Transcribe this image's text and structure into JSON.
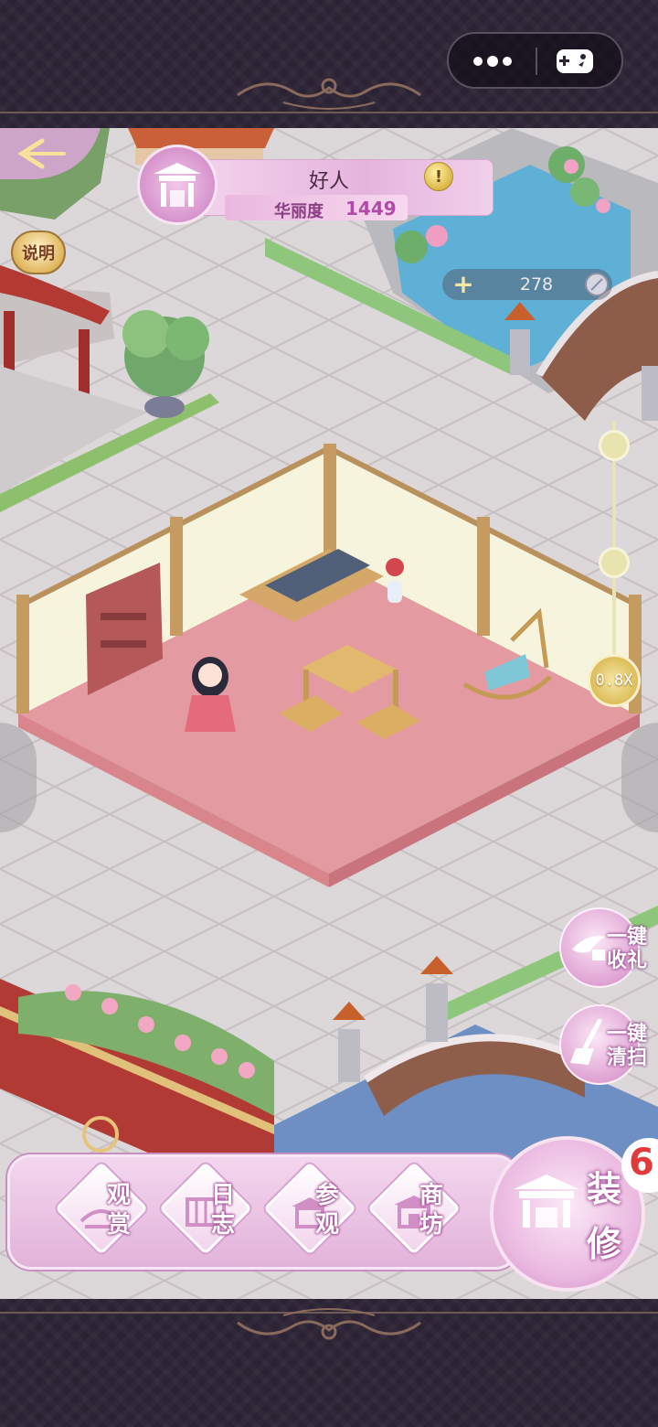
{
  "capsule": {
    "more_icon": "more-dots-icon",
    "game_icon": "gamepad-icon"
  },
  "top_bar": {
    "help_label": "说明",
    "profile": {
      "name": "好人",
      "score_label": "华丽度",
      "score_value": "1449",
      "alert_label": "!"
    },
    "currency": {
      "plus_label": "+",
      "amount": "278"
    }
  },
  "zoom": {
    "level_label": "0.8X",
    "levels": 3,
    "current_level": 3
  },
  "side_actions": [
    {
      "label": "一键收礼",
      "line1": "一键",
      "line2": "收礼",
      "icon": "bird-gift-icon"
    },
    {
      "label": "一键清扫",
      "line1": "一键",
      "line2": "清扫",
      "icon": "broom-icon"
    }
  ],
  "bottom_menu": [
    {
      "line1": "观",
      "line2": "赏",
      "icon": "view-icon"
    },
    {
      "line1": "日",
      "line2": "志",
      "icon": "journal-icon"
    },
    {
      "line1": "参",
      "line2": "观",
      "icon": "visit-icon"
    },
    {
      "line1": "商",
      "line2": "坊",
      "icon": "shop-icon"
    }
  ],
  "decorate": {
    "line1": "装",
    "line2": "修"
  },
  "logo_badge": {
    "text": "6"
  },
  "colors": {
    "accent": "#e2b3da",
    "brand_gold": "#d9b84e",
    "floor": "#e39aa0"
  }
}
